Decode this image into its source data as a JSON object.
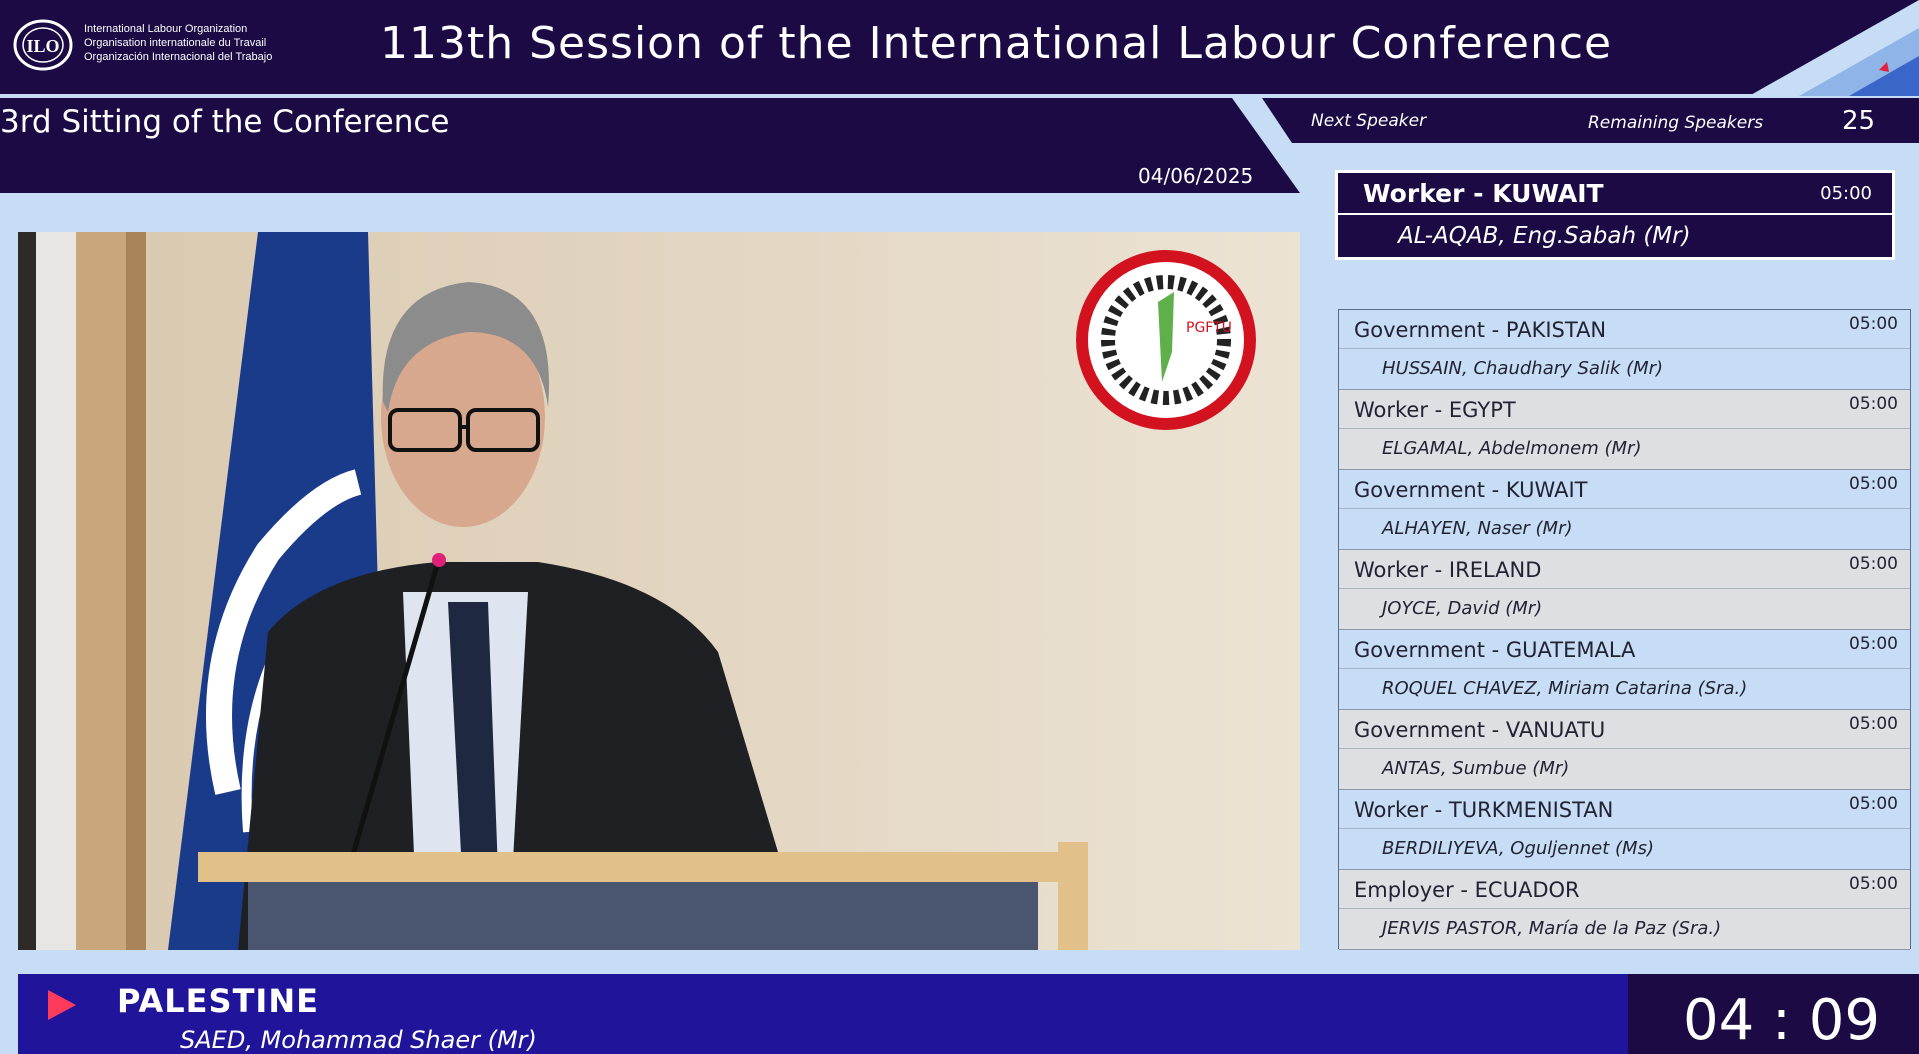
{
  "organization": {
    "names": [
      "International Labour Organization",
      "Organisation internationale du Travail",
      "Organización Internacional del Trabajo"
    ],
    "logo_icon": "ilo-logo-icon"
  },
  "conference_title": "113th Session of the International Labour Conference",
  "sitting": {
    "title": "3rd Sitting of the Conference",
    "date": "04/06/2025"
  },
  "queue": {
    "next_speaker_label": "Next Speaker",
    "remaining_label": "Remaining Speakers",
    "remaining_count": "25"
  },
  "next_speaker": {
    "group_country": "Worker - KUWAIT",
    "time": "05:00",
    "name": "AL-AQAB, Eng.Sabah (Mr)"
  },
  "speakers": [
    {
      "group_country": "Government - PAKISTAN",
      "time": "05:00",
      "name": "HUSSAIN, Chaudhary Salik (Mr)"
    },
    {
      "group_country": "Worker - EGYPT",
      "time": "05:00",
      "name": "ELGAMAL, Abdelmonem (Mr)"
    },
    {
      "group_country": "Government - KUWAIT",
      "time": "05:00",
      "name": "ALHAYEN, Naser (Mr)"
    },
    {
      "group_country": "Worker - IRELAND",
      "time": "05:00",
      "name": "JOYCE, David (Mr)"
    },
    {
      "group_country": "Government - GUATEMALA",
      "time": "05:00",
      "name": "ROQUEL CHAVEZ, Miriam Catarina (Sra.)"
    },
    {
      "group_country": "Government - VANUATU",
      "time": "05:00",
      "name": "ANTAS, Sumbue (Mr)"
    },
    {
      "group_country": "Worker - TURKMENISTAN",
      "time": "05:00",
      "name": "BERDILIYEVA, Oguljennet (Ms)"
    },
    {
      "group_country": "Employer - ECUADOR",
      "time": "05:00",
      "name": "JERVIS PASTOR, María de la Paz (Sra.)"
    }
  ],
  "current_speaker": {
    "country": "PALESTINE",
    "name": "SAED, Mohammad Shaer (Mr)",
    "timer": "04 : 09"
  },
  "video": {
    "emblem_icon": "pgftu-emblem-icon",
    "emblem_text": "PGFTU",
    "flag_icon": "un-flag-icon"
  },
  "colors": {
    "navy": "#1b0a44",
    "light_blue": "#c6ddf5",
    "bar_blue": "#1f149a",
    "accent_red": "#ff3b5c"
  }
}
